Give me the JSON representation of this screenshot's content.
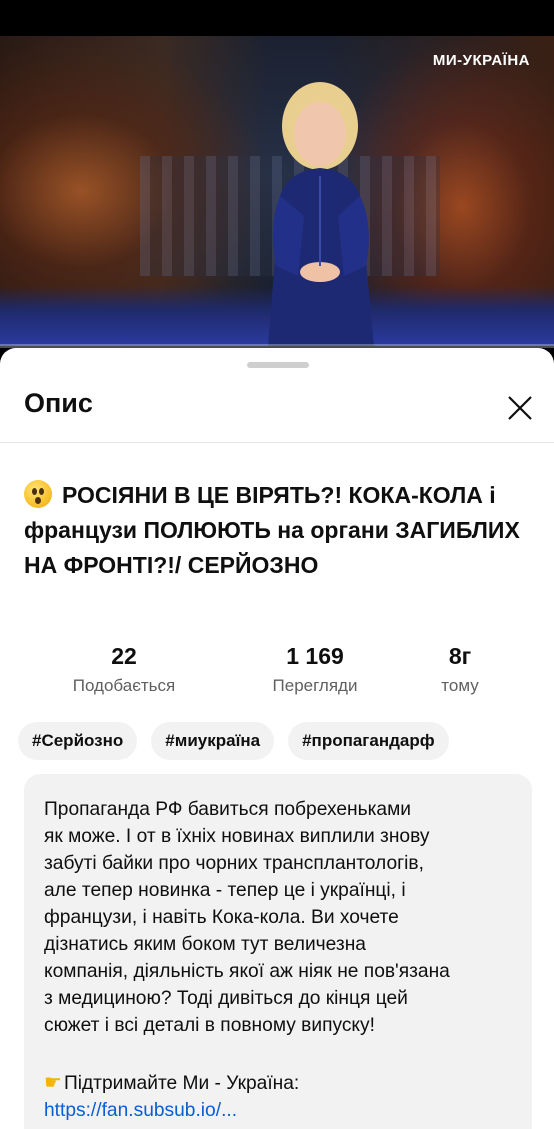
{
  "video": {
    "watermark": "МИ-УКРАЇНА",
    "progress_fraction": 0.0
  },
  "sheet": {
    "title": "Опис",
    "close_icon": "close-icon"
  },
  "video_title": {
    "emoji": "astonished-face",
    "text": "РОСІЯНИ В ЦЕ ВІРЯТЬ?! КОКА-КОЛА і французи ПОЛЮЮТЬ на органи ЗАГИБЛИХ НА ФРОНТІ?!/ СЕРЙОЗНО"
  },
  "stats": [
    {
      "value": "22",
      "label": "Подобається"
    },
    {
      "value": "1 169",
      "label": "Перегляди"
    },
    {
      "value": "8г",
      "label": "тому"
    }
  ],
  "hashtags": [
    "#Серйозно",
    "#миукраїна",
    "#пропагандарф"
  ],
  "description": {
    "text": "Пропаганда РФ бавиться побрехеньками\nяк може. І от в їхніх новинах виплили знову\nзабуті байки про чорних трансплантологів,\nале тепер новинка - тепер це і українці, і\nфранцузи, і навіть Кока-кола. Ви хочете\nдізнатись яким боком тут величезна\nкомпанія, діяльність якої аж ніяк не пов'язана\nз медициною? Тоді дивіться до кінця цей\nсюжет і всі деталі в повному випуску!",
    "support_text": "Підтримайте Ми - Україна:",
    "support_icon": "pointing-hand-icon",
    "link": "https://fan.subsub.io/..."
  },
  "colors": {
    "link": "#065fd4",
    "chip_bg": "#f2f2f2",
    "progress": "#ff0000"
  }
}
